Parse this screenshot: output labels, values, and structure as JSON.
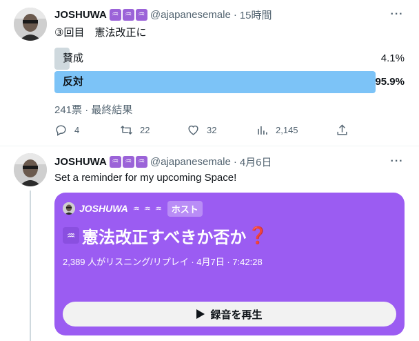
{
  "tweet1": {
    "author": {
      "name": "JOSHUWA",
      "badges": [
        "♒",
        "♒",
        "♒"
      ],
      "handle": "@ajapanesemale",
      "time": "15時間"
    },
    "text": "③回目　憲法改正に",
    "poll": {
      "options": [
        {
          "label": "賛成",
          "percent": "4.1%",
          "fraction": 0.041,
          "winner": false
        },
        {
          "label": "反対",
          "percent": "95.9%",
          "fraction": 0.959,
          "winner": true
        }
      ],
      "meta": "241票 · 最終結果"
    },
    "actions": {
      "reply_count": "4",
      "retweet_count": "22",
      "like_count": "32",
      "views_count": "2,145"
    }
  },
  "tweet2": {
    "author": {
      "name": "JOSHUWA",
      "badges": [
        "♒",
        "♒",
        "♒"
      ],
      "handle": "@ajapanesemale",
      "time": "4月6日"
    },
    "text": "Set a reminder for my upcoming Space!",
    "space": {
      "host_name": "JOSHUWA",
      "host_badges": [
        "♒",
        "♒",
        "♒"
      ],
      "host_tag": "ホスト",
      "title_badge": "♒",
      "title": "憲法改正すべきか否か",
      "title_mark": "❓",
      "stats": "2,389 人がリスニング/リプレイ · 4月7日 · 7:42:28",
      "play_label": "録音を再生"
    }
  },
  "colors": {
    "winner_bar": "#7cc3f7",
    "loser_bar": "#cfd9de",
    "space_bg": "#9b5cf2",
    "badge": "#9b63d8",
    "muted": "#536471"
  },
  "icons": {
    "reply": "reply-icon",
    "retweet": "retweet-icon",
    "like": "heart-icon",
    "views": "views-icon",
    "share": "share-icon",
    "more": "more-icon",
    "play": "play-icon"
  }
}
